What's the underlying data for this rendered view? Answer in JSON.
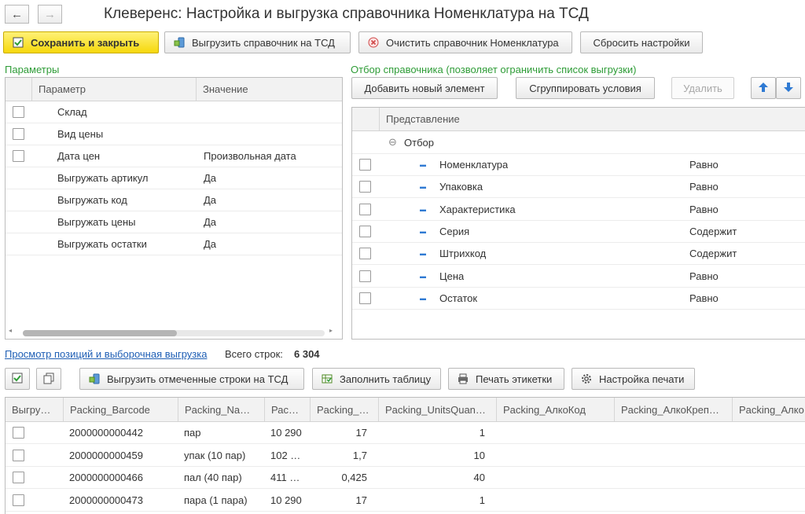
{
  "window": {
    "title": "Клеверенс: Настройка и выгрузка справочника Номенклатура на ТСД",
    "back_glyph": "←",
    "forward_glyph": "→"
  },
  "toolbar": {
    "save_close": "Сохранить и закрыть",
    "export_catalog": "Выгрузить справочник на ТСД",
    "clear_catalog": "Очистить справочник Номенклатура",
    "reset_settings": "Сбросить настройки"
  },
  "params": {
    "label": "Параметры",
    "columns": [
      "Параметр",
      "Значение"
    ],
    "rows": [
      {
        "has_check": true,
        "name": "Склад",
        "value": ""
      },
      {
        "has_check": true,
        "name": "Вид цены",
        "value": ""
      },
      {
        "has_check": true,
        "name": "Дата цен",
        "value": "Произвольная дата"
      },
      {
        "has_check": false,
        "name": "Выгружать артикул",
        "value": "Да"
      },
      {
        "has_check": false,
        "name": "Выгружать код",
        "value": "Да"
      },
      {
        "has_check": false,
        "name": "Выгружать цены",
        "value": "Да"
      },
      {
        "has_check": false,
        "name": "Выгружать остатки",
        "value": "Да"
      }
    ]
  },
  "filter": {
    "label": "Отбор справочника (позволяет ограничить список выгрузки)",
    "add_button": "Добавить новый элемент",
    "group_button": "Сгруппировать условия",
    "delete_button": "Удалить",
    "column": "Представление",
    "group_name": "Отбор",
    "group_toggle_glyph": "⊖",
    "item_glyph": "▬",
    "items": [
      {
        "name": "Номенклатура",
        "condition": "Равно"
      },
      {
        "name": "Упаковка",
        "condition": "Равно"
      },
      {
        "name": "Характеристика",
        "condition": "Равно"
      },
      {
        "name": "Серия",
        "condition": "Содержит"
      },
      {
        "name": "Штрихкод",
        "condition": "Содержит"
      },
      {
        "name": "Цена",
        "condition": "Равно"
      },
      {
        "name": "Остаток",
        "condition": "Равно"
      }
    ]
  },
  "preview": {
    "link": "Просмотр позиций и выборочная выгрузка",
    "total_label": "Всего строк:",
    "total_value": "6 304",
    "export_marked": "Выгрузить отмеченные строки на ТСД",
    "fill_table": "Заполнить таблицу",
    "print_labels": "Печать этикетки",
    "print_settings": "Настройка печати",
    "columns": [
      "Выгру…",
      "Packing_Barcode",
      "Packing_Na…",
      "Рас…",
      "Packing_…",
      "Packing_UnitsQuan…",
      "Packing_АлкоКод",
      "Packing_АлкоКреп…",
      "Packing_Алко"
    ],
    "rows": [
      {
        "barcode": "2000000000442",
        "name": "пар",
        "price": "10 290",
        "c4": "17",
        "units": "1"
      },
      {
        "barcode": "2000000000459",
        "name": "упак (10 пар)",
        "price": "102 …",
        "c4": "1,7",
        "units": "10"
      },
      {
        "barcode": "2000000000466",
        "name": "пал (40 пар)",
        "price": "411 …",
        "c4": "0,425",
        "units": "40"
      },
      {
        "barcode": "2000000000473",
        "name": "пара (1 пара)",
        "price": "10 290",
        "c4": "17",
        "units": "1"
      }
    ]
  },
  "colors": {
    "accent_yellow": "#f6d80c",
    "section_green": "#2e9c37",
    "link_blue": "#1f5fb5"
  }
}
